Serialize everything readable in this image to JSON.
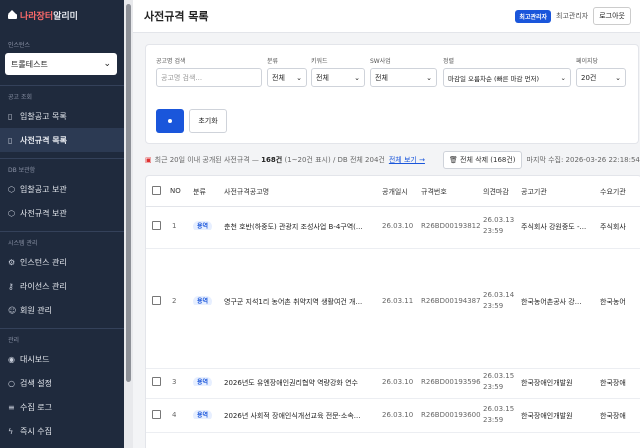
{
  "app": {
    "name_part1": "나라장터",
    "name_part2": "알리미"
  },
  "sidebar": {
    "instance_label": "인스턴스",
    "instance_value": "트롤테스트",
    "sections": [
      {
        "label": "공고 조회",
        "items": [
          {
            "label": "입찰공고 목록",
            "icon": "doc"
          },
          {
            "label": "사전규격 목록",
            "icon": "doc"
          }
        ]
      },
      {
        "label": "DB 보관함",
        "items": [
          {
            "label": "입찰공고 보관",
            "icon": "box"
          },
          {
            "label": "사전규격 보관",
            "icon": "box"
          }
        ]
      },
      {
        "label": "시스템 관리",
        "items": [
          {
            "label": "인스턴스 관리",
            "icon": "gear"
          },
          {
            "label": "라이선스 관리",
            "icon": "key"
          },
          {
            "label": "회원 관리",
            "icon": "user"
          }
        ]
      },
      {
        "label": "관리",
        "items": [
          {
            "label": "대시보드",
            "icon": "dash"
          },
          {
            "label": "검색 설정",
            "icon": "search"
          },
          {
            "label": "수집 로그",
            "icon": "log"
          },
          {
            "label": "즉시 수집",
            "icon": "bolt"
          }
        ]
      }
    ]
  },
  "header": {
    "title": "사전규격 목록",
    "badge": "최고관리자",
    "user": "최고관리자",
    "logout": "로그아웃"
  },
  "filters": {
    "search_label": "공고명 검색",
    "search_placeholder": "공고명 검색...",
    "category_label": "분류",
    "category_value": "전체",
    "keyword_label": "키워드",
    "keyword_value": "전체",
    "sw_label": "SW사업",
    "sw_value": "전체",
    "sort_label": "정렬",
    "sort_value": "마감일 오름차순 (빠른 마감 먼저)",
    "perpage_label": "페이지당",
    "perpage_value": "20건",
    "reset_label": "초기화"
  },
  "summary": {
    "text1": "최근 20일 이내 공개된 사전규격 —",
    "count": "168건",
    "text2": "(1~20건 표시)",
    "db_text": "/ DB 전체 204건",
    "view_all": "전체 보기 →",
    "delete_all": "🗑 전체 삭제 (168건)",
    "last_updated": "마지막 수집: 2026-03-26 22:18:54"
  },
  "table": {
    "columns": [
      "NO",
      "분류",
      "사전규격공고명",
      "공개일시",
      "규격번호",
      "의견마감",
      "공고기관",
      "수요기관"
    ],
    "rows": [
      {
        "no": "1",
        "category": "용역",
        "title": "춘천 호반(하중도) 관광지 조성사업 B-4구역(...",
        "date": "26.03.10",
        "ref": "R26BD00193812",
        "deadline_date": "26.03.13",
        "deadline_time": "23:59",
        "agency": "주식회사 강원중도 -...",
        "demand": "주식회사"
      },
      {
        "no": "2",
        "category": "용역",
        "title": "영구군 지석1리 농어촌 취약지역 생활여건 개...",
        "date": "26.03.11",
        "ref": "R26BD00194387",
        "deadline_date": "26.03.14",
        "deadline_time": "23:59",
        "agency": "한국농어촌공사 강...",
        "demand": "한국농어"
      },
      {
        "no": "3",
        "category": "용역",
        "title": "2026년도 유엔장애인권리협약 역량강화 연수",
        "date": "26.03.10",
        "ref": "R26BD00193596",
        "deadline_date": "26.03.15",
        "deadline_time": "23:59",
        "agency": "한국장애인개발원",
        "demand": "한국장애"
      },
      {
        "no": "4",
        "category": "용역",
        "title": "2026년 사회적 장애인식개선교육 전문·소속...",
        "date": "26.03.10",
        "ref": "R26BD00193600",
        "deadline_date": "26.03.15",
        "deadline_time": "23:59",
        "agency": "한국장애인개발원",
        "demand": "한국장애"
      }
    ]
  }
}
